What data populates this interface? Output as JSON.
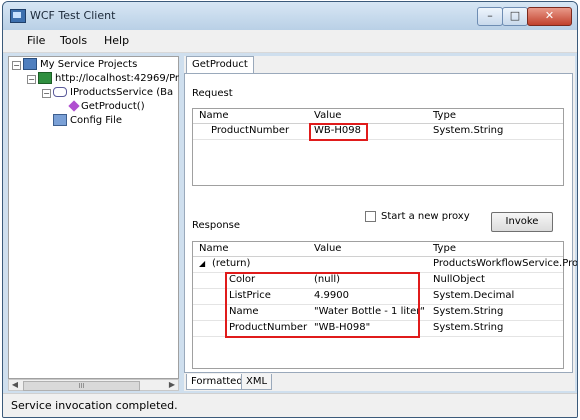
{
  "window": {
    "title": "WCF Test Client",
    "close_glyph": "✕",
    "min_glyph": "–",
    "max_glyph": "□"
  },
  "menu": {
    "file": "File",
    "tools": "Tools",
    "help": "Help"
  },
  "tree": {
    "root": "My Service Projects",
    "endpoint": "http://localhost:42969/Pr",
    "contract": "IProductsService (Ba",
    "operation": "GetProduct()",
    "config": "Config File"
  },
  "tabs": {
    "main": "GetProduct",
    "formatted": "Formatted",
    "xml": "XML"
  },
  "request": {
    "label": "Request",
    "headers": [
      "Name",
      "Value",
      "Type"
    ],
    "rows": [
      {
        "name": "ProductNumber",
        "value": "WB-H098",
        "type": "System.String"
      }
    ]
  },
  "proxy_checkbox": {
    "label": "Start a new proxy",
    "checked": false
  },
  "invoke": {
    "label": "Invoke"
  },
  "response": {
    "label": "Response",
    "headers": [
      "Name",
      "Value",
      "Type"
    ],
    "root": {
      "name": "(return)",
      "value": "",
      "type": "ProductsWorkflowService.Proc"
    },
    "rows": [
      {
        "name": "Color",
        "value": "(null)",
        "type": "NullObject"
      },
      {
        "name": "ListPrice",
        "value": "4.9900",
        "type": "System.Decimal"
      },
      {
        "name": "Name",
        "value": "\"Water Bottle - 1 liter\"",
        "type": "System.String"
      },
      {
        "name": "ProductNumber",
        "value": "\"WB-H098\"",
        "type": "System.String"
      }
    ]
  },
  "status": {
    "text": "Service invocation completed."
  },
  "colors": {
    "highlight": "#e01b1b",
    "titlebar": "#c8dbee"
  }
}
